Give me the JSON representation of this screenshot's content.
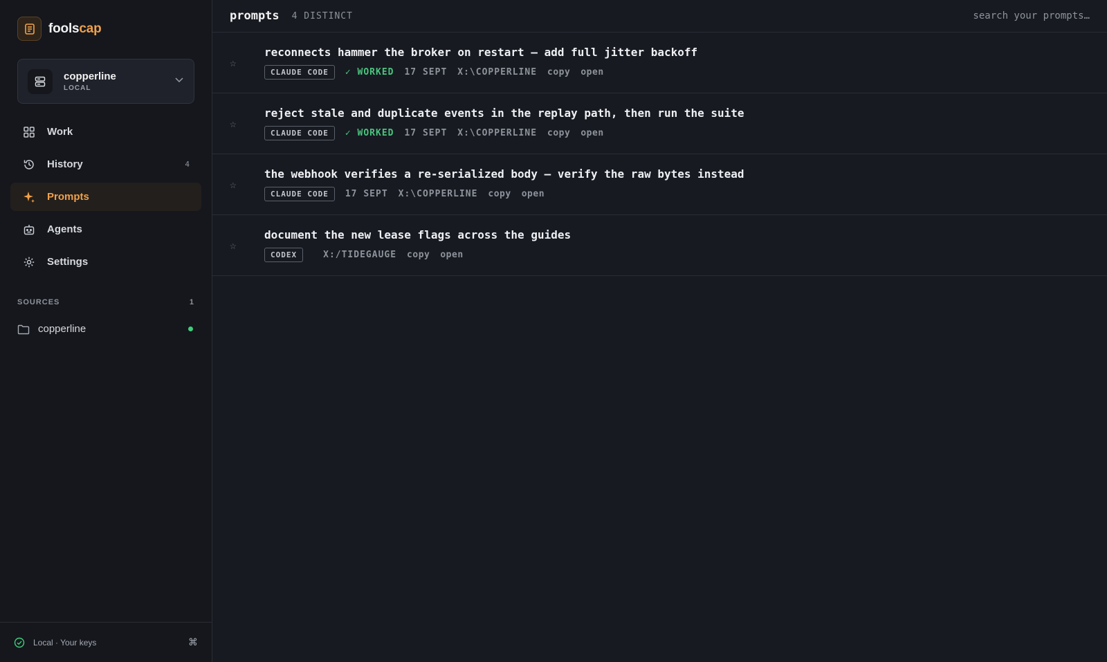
{
  "brand": {
    "name_part1": "fools",
    "name_part2": "cap",
    "accent": "#f0a14a"
  },
  "workspace": {
    "name": "copperline",
    "label": "LOCAL"
  },
  "nav": {
    "items": [
      {
        "label": "Work",
        "icon": "grid-icon",
        "count": ""
      },
      {
        "label": "History",
        "icon": "history-icon",
        "count": "4"
      },
      {
        "label": "Prompts",
        "icon": "sparkle-icon",
        "count": "",
        "active": true
      },
      {
        "label": "Agents",
        "icon": "robot-icon",
        "count": ""
      },
      {
        "label": "Settings",
        "icon": "gear-icon",
        "count": ""
      }
    ]
  },
  "sources": {
    "heading": "SOURCES",
    "count": "1",
    "items": [
      {
        "label": "copperline",
        "status_color": "#3ecf7a"
      }
    ]
  },
  "footer": {
    "label": "Local · Your keys",
    "shortcut": "⌘"
  },
  "header": {
    "title": "prompts",
    "subtitle": "4 DISTINCT",
    "search_placeholder": "search your prompts…"
  },
  "prompts": [
    {
      "title": "reconnects hammer the broker on restart — add full jitter backoff",
      "agent": "CLAUDE CODE",
      "status": "✓ WORKED",
      "date": "17 SEPT",
      "path": "X:\\COPPERLINE",
      "copy": "copy",
      "open": "open"
    },
    {
      "title": "reject stale and duplicate events in the replay path, then run the suite",
      "agent": "CLAUDE CODE",
      "status": "✓ WORKED",
      "date": "17 SEPT",
      "path": "X:\\COPPERLINE",
      "copy": "copy",
      "open": "open"
    },
    {
      "title": "the webhook verifies a re-serialized body — verify the raw bytes instead",
      "agent": "CLAUDE CODE",
      "status": "",
      "date": "17 SEPT",
      "path": "X:\\COPPERLINE",
      "copy": "copy",
      "open": "open"
    },
    {
      "title": "document the new lease flags across the guides",
      "agent": "CODEX",
      "status": "",
      "date": "",
      "path": "X:/TIDEGAUGE",
      "copy": "copy",
      "open": "open"
    }
  ]
}
